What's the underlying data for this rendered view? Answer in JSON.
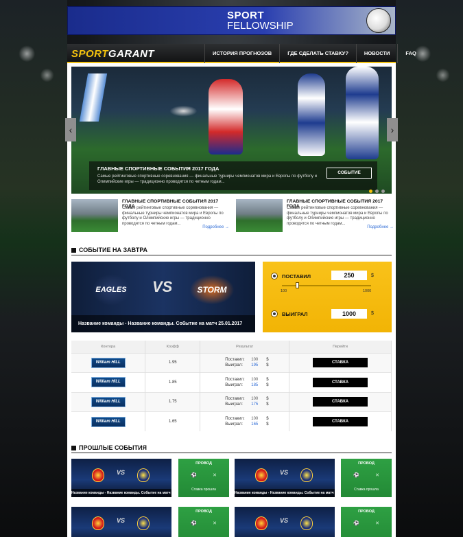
{
  "banner": {
    "title": "SPORT",
    "subtitle": "FELLOWSHIP"
  },
  "logo": {
    "part1": "SPORT",
    "part2": "GARANT"
  },
  "nav": [
    "ИСТОРИЯ ПРОГНОЗОВ",
    "ГДЕ СДЕЛАТЬ СТАВКУ?",
    "НОВОСТИ",
    "FAQ"
  ],
  "hero": {
    "title": "ГЛАВНЫЕ СПОРТИВНЫЕ СОБЫТИЯ 2017 ГОДА",
    "desc": "Самые рейтинговые спортивные соревнования — финальные турниры чемпионатов мира и Европы по футболу и Олимпийские игры — традиционно проводятся по четным годам...",
    "button": "СОБЫТИЕ",
    "prev": "‹",
    "next": "›"
  },
  "news": [
    {
      "title": "ГЛАВНЫЕ СПОРТИВНЫЕ СОБЫТИЯ 2017 ГОДА",
      "desc": "Самые рейтинговые спортивные соревнования — финальные турниры чемпионатов мира и Европы по футболу и Олимпийские игры — традиционно проводятся по четным годам...",
      "more": "Подробнее"
    },
    {
      "title": "ГЛАВНЫЕ СПОРТИВНЫЕ СОБЫТИЯ 2017 ГОДА",
      "desc": "Самые рейтинговые спортивные соревнования — финальные турниры чемпионатов мира и Европы по футболу и Олимпийские игры — традиционно проводятся по четным годам...",
      "more": "Подробнее"
    }
  ],
  "tomorrow": {
    "heading": "СОБЫТИЕ НА ЗАВТРА",
    "team1": "EAGLES",
    "vs": "VS",
    "team2": "STORM",
    "caption": "Название команды - Название команды. Событие на матч 25.01.2017"
  },
  "bet": {
    "label_bet": "ПОСТАВИЛ",
    "bet_value": "250",
    "currency": "$",
    "slider_min": "100",
    "slider_max": "1000",
    "slider_value": 250,
    "label_win": "ВЫИГРАЛ",
    "win_value": "1000"
  },
  "odds": {
    "headers": [
      "Контора",
      "Коэфф",
      "Результат",
      "Перейти"
    ],
    "result_labels": {
      "bet": "Поставил:",
      "win": "Выиграл:",
      "currency": "$"
    },
    "rows": [
      {
        "bookie": "William HILL",
        "coef": "1.95",
        "bet": "100",
        "win": "195",
        "button": "СТАВКА"
      },
      {
        "bookie": "William HILL",
        "coef": "1.85",
        "bet": "100",
        "win": "185",
        "button": "СТАВКА"
      },
      {
        "bookie": "William HILL",
        "coef": "1.75",
        "bet": "100",
        "win": "175",
        "button": "СТАВКА"
      },
      {
        "bookie": "William HILL",
        "coef": "1.65",
        "bet": "100",
        "win": "165",
        "button": "СТАВКА"
      }
    ]
  },
  "past": {
    "heading": "ПРОШЛЫЕ СОБЫТИЯ",
    "vs": "VS",
    "caption": "Название команды - Название команды. Событие на матч 25.01.2017",
    "status_title": "ПРОВОД",
    "status_text": "Ставка прошла",
    "status_icons": [
      "⚽",
      "✕"
    ]
  }
}
